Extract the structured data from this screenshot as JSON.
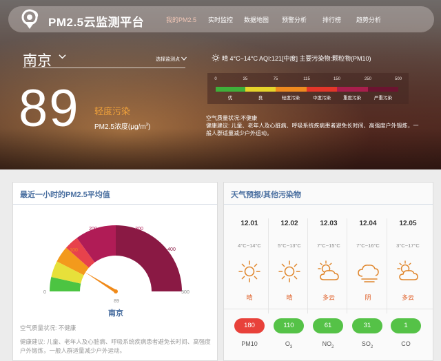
{
  "nav": {
    "title": "PM2.5云监测平台",
    "items": [
      {
        "label": "我的PM2.5",
        "active": true
      },
      {
        "label": "实时监控",
        "active": false
      },
      {
        "label": "数据地图",
        "active": false
      },
      {
        "label": "预警分析",
        "active": false
      },
      {
        "label": "排行榜",
        "active": false
      },
      {
        "label": "趋势分析",
        "active": false
      }
    ]
  },
  "hero": {
    "city": "南京",
    "station_select": "选择监测点",
    "aqi_value": "89",
    "aqi_level": "轻度污染",
    "aqi_unit_main": "PM2.5浓度(μg/m",
    "aqi_unit_sup": "3",
    "aqi_unit_close": ")",
    "weather_summary": "晴 4°C~14°C AQI:121[中度]  主要污染物:颗粒物(PM10)",
    "quality_title": "空气质量状况:不健康",
    "advice": "健康建议: 儿童、老年人及心脏病、呼吸系统疾病患者避免长时间、高强度户外锻炼，一般人群适量减少户外运动。"
  },
  "aqi_scale": {
    "ticks": [
      "0",
      "35",
      "75",
      "115",
      "150",
      "250",
      "500"
    ],
    "bands": [
      {
        "label": "优",
        "color": "#3fb03a"
      },
      {
        "label": "良",
        "color": "#e6d42a"
      },
      {
        "label": "轻度污染",
        "color": "#ef8a1f"
      },
      {
        "label": "中度污染",
        "color": "#e3362a"
      },
      {
        "label": "重度污染",
        "color": "#a81e4c"
      },
      {
        "label": "严重污染",
        "color": "#6b1430"
      }
    ]
  },
  "left_card": {
    "title": "最近一小时的PM2.5平均值",
    "gauge": {
      "min": "0",
      "max": "500",
      "value": 89,
      "value_label": "89",
      "scale_labels": [
        "0",
        "100",
        "200",
        "300",
        "400",
        "500"
      ]
    },
    "city": "南京",
    "status": "空气质量状况: 不健康",
    "advice": "健康建议: 儿童、老年人及心脏病、呼吸系统疾病患者避免长时间、高强度户外锻炼，一般人群适量减少户外运动。"
  },
  "right_card": {
    "title": "天气预报/其他污染物",
    "forecast": [
      {
        "date": "12.01",
        "temp": "4°C~14°C",
        "icon": "sun-icon",
        "cond": "晴"
      },
      {
        "date": "12.02",
        "temp": "5°C~13°C",
        "icon": "sun-icon",
        "cond": "晴"
      },
      {
        "date": "12.03",
        "temp": "7°C~15°C",
        "icon": "partly-cloudy-icon",
        "cond": "多云"
      },
      {
        "date": "12.04",
        "temp": "7°C~16°C",
        "icon": "overcast-icon",
        "cond": "阴"
      },
      {
        "date": "12.05",
        "temp": "3°C~17°C",
        "icon": "partly-cloudy-icon",
        "cond": "多云"
      }
    ],
    "pollutants": [
      {
        "value": "180",
        "name": "PM10",
        "sub": "",
        "color": "#e8413a"
      },
      {
        "value": "110",
        "name": "O",
        "sub": "3",
        "color": "#55c247"
      },
      {
        "value": "61",
        "name": "NO",
        "sub": "2",
        "color": "#55c247"
      },
      {
        "value": "31",
        "name": "SO",
        "sub": "2",
        "color": "#55c247"
      },
      {
        "value": "1",
        "name": "CO",
        "sub": "",
        "color": "#55c247"
      }
    ]
  }
}
